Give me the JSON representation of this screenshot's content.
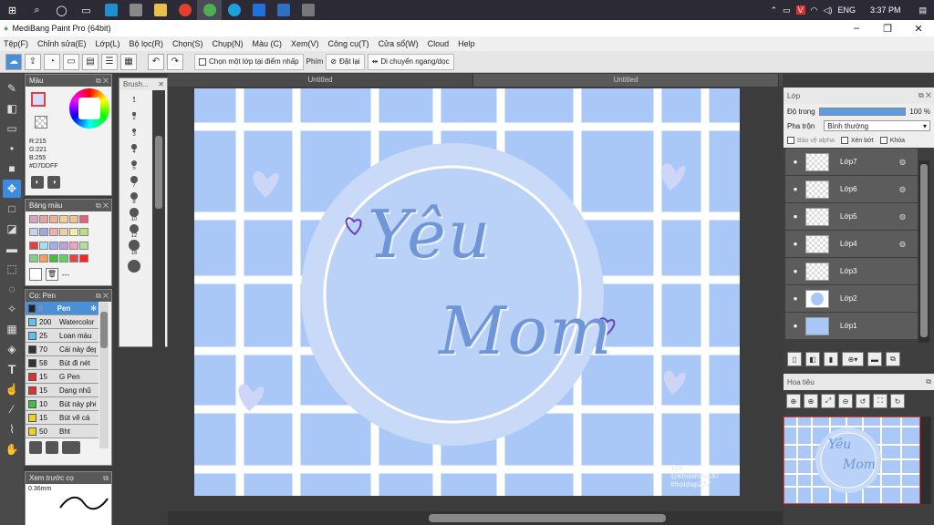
{
  "taskbar": {
    "language": "ENG",
    "time": "3:37 PM"
  },
  "window": {
    "title": "MediBang Paint Pro (64bit)"
  },
  "menu": [
    "Tệp(F)",
    "Chỉnh sửa(E)",
    "Lớp(L)",
    "Bộ lọc(R)",
    "Chọn(S)",
    "Chụp(N)",
    "Màu (C)",
    "Xem(V)",
    "Công cụ(T)",
    "Cửa sổ(W)",
    "Cloud",
    "Help"
  ],
  "toolbar": {
    "sample_label": "Chọn một lớp tại điểm nhấp",
    "phim_label": "Phím",
    "reset_label": "Đặt lại",
    "move_label": "Di chuyển ngang/dọc"
  },
  "color_panel": {
    "title": "Màu",
    "r": "R:215",
    "g": "G:221",
    "b": "B:255",
    "hex": "#D7DDFF"
  },
  "palette_panel": {
    "title": "Bảng màu",
    "dash": "---",
    "swatches": [
      "#d9a0c0",
      "#e6a0a0",
      "#f0b090",
      "#f0d090",
      "#f5c090",
      "#e06080",
      "#c8d0f0",
      "#a0a8e0",
      "#f0b0b0",
      "#f0d0a0",
      "#f0f0a0",
      "#c0e080",
      "#e04040",
      "#a0e0f0",
      "#a0b0f0",
      "#c0a0e0",
      "#f0a0c0",
      "#b0e0a0",
      "#80d080",
      "#f0a060",
      "#40c040",
      "#60d060",
      "#f04040",
      "#ff2020"
    ]
  },
  "brush_panel": {
    "title": "Cọ: Pen",
    "items": [
      {
        "size": "5",
        "name": "Pen",
        "color": "#222222",
        "selected": true
      },
      {
        "size": "200",
        "name": "Watercolor",
        "color": "#60c0f0"
      },
      {
        "size": "25",
        "name": "Loan màu",
        "color": "#60c0f0"
      },
      {
        "size": "70",
        "name": "Cái này đẹp",
        "color": "#333333"
      },
      {
        "size": "58",
        "name": "Bút đi nét",
        "color": "#333333"
      },
      {
        "size": "15",
        "name": "G Pen",
        "color": "#e03030"
      },
      {
        "size": "15",
        "name": "Dạng nhũ",
        "color": "#e03030"
      },
      {
        "size": "10",
        "name": "Bút này phê",
        "color": "#40c040"
      },
      {
        "size": "15",
        "name": "Bút vẽ cá",
        "color": "#f0d020"
      },
      {
        "size": "50",
        "name": "Bht",
        "color": "#f0d020"
      }
    ]
  },
  "preview_panel": {
    "title": "Xem trước cọ",
    "size": "0.36mm"
  },
  "brush_size_panel": {
    "title": "Brush...",
    "sizes": [
      "1",
      "2",
      "3",
      "4",
      "5",
      "7",
      "8",
      "10",
      "12",
      "16"
    ]
  },
  "tabs": [
    "Untitled",
    "Untitled"
  ],
  "artwork": {
    "title_line1": "Yêu",
    "title_line2": "Mom",
    "watermark_line1": "Tea",
    "watermark_line2": "@khiemvu197",
    "watermark_line3": "#hoidap247"
  },
  "layer_panel": {
    "title": "Lớp",
    "opacity_label": "Độ trong",
    "opacity_value": "100 %",
    "opacity": 1.0,
    "blend_label": "Pha trộn",
    "blend_value": "Bình thường",
    "protect_alpha": "Bảo vệ alpha",
    "clipping": "Xén bớt",
    "lock": "Khóa",
    "layers": [
      "Lớp7",
      "Lớp6",
      "Lớp5",
      "Lớp4",
      "Lớp3",
      "Lớp2",
      "Lớp1"
    ]
  },
  "navigator": {
    "title": "Hoa tiêu",
    "mini_title_line1": "Yêu",
    "mini_title_line2": "Mom"
  }
}
